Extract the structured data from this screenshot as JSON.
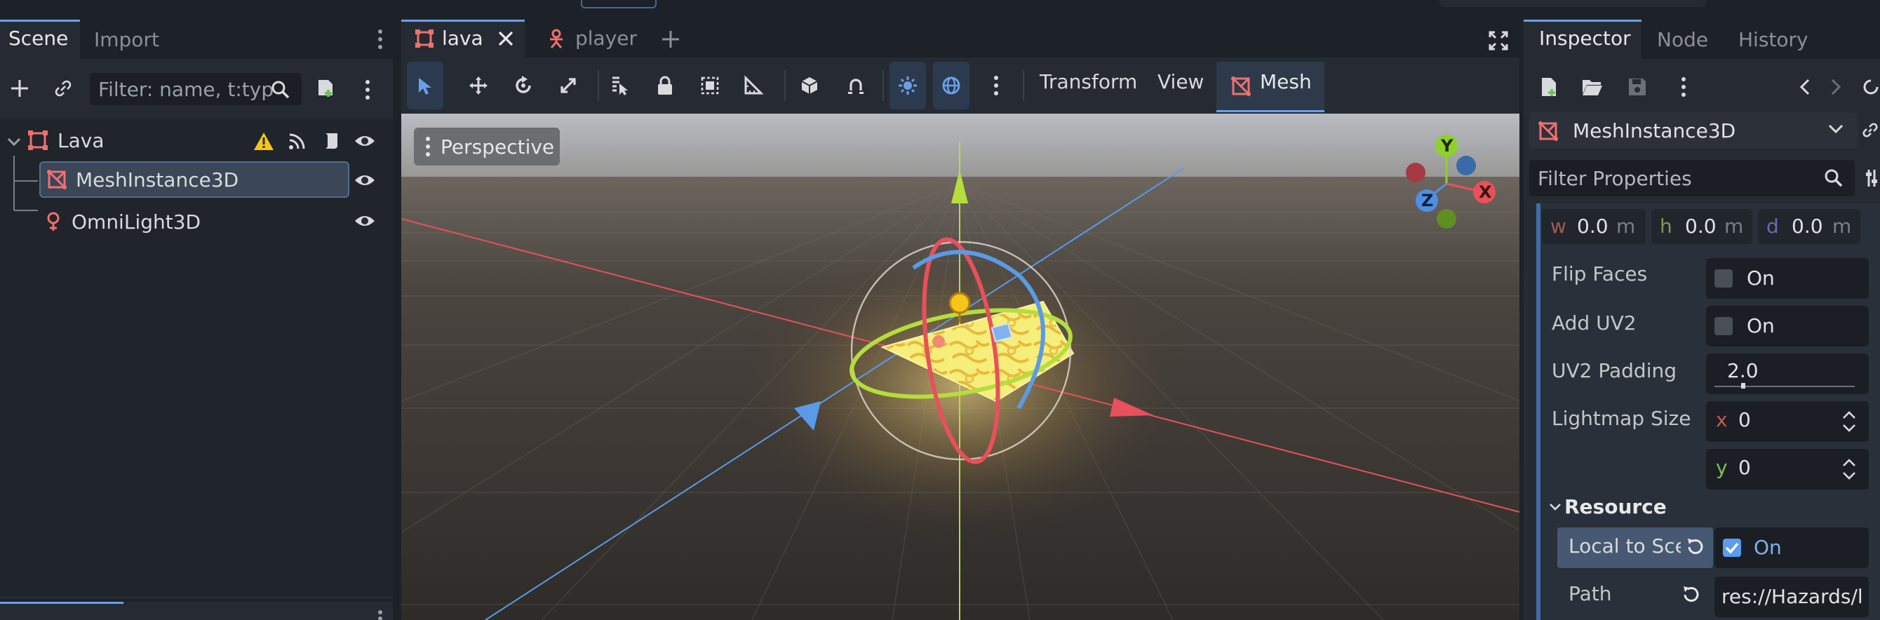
{
  "left_dock": {
    "tabs": [
      {
        "label": "Scene",
        "active": true
      },
      {
        "label": "Import",
        "active": false
      }
    ],
    "filter_placeholder": "Filter: name, t:typ",
    "tree": [
      {
        "label": "Lava",
        "icon": "node3d-icon",
        "warning": true
      },
      {
        "label": "MeshInstance3D",
        "icon": "mesh-instance-icon",
        "selected": true
      },
      {
        "label": "OmniLight3D",
        "icon": "omni-light-icon"
      }
    ]
  },
  "editor_tabs": [
    {
      "label": "lava",
      "active": true,
      "closable": true
    },
    {
      "label": "player",
      "active": false
    }
  ],
  "toolbar": {
    "menus": [
      "Transform",
      "View",
      "Mesh"
    ],
    "active_menu": "Mesh"
  },
  "viewport": {
    "perspective_label": "Perspective",
    "gizmo_axes": [
      "Y",
      "X",
      "Z"
    ]
  },
  "inspector": {
    "tabs": [
      {
        "label": "Inspector",
        "active": true
      },
      {
        "label": "Node"
      },
      {
        "label": "History"
      }
    ],
    "node_type": "MeshInstance3D",
    "filter_placeholder": "Filter Properties",
    "size": {
      "w_label": "w",
      "w_value": "0.0",
      "w_unit": "m",
      "h_label": "h",
      "h_value": "0.0",
      "h_unit": "m",
      "d_label": "d",
      "d_value": "0.0",
      "d_unit": "m"
    },
    "flip_faces": {
      "label": "Flip Faces",
      "value": "On",
      "checked": false
    },
    "add_uv2": {
      "label": "Add UV2",
      "value": "On",
      "checked": false
    },
    "uv2_padding": {
      "label": "UV2 Padding",
      "value": "2.0"
    },
    "lightmap_size": {
      "label": "Lightmap Size",
      "x_label": "x",
      "x_value": "0",
      "y_label": "y",
      "y_value": "0"
    },
    "resource_section": "Resource",
    "local_to_scene": {
      "label": "Local to Sce",
      "value": "On",
      "checked": true
    },
    "path": {
      "label": "Path",
      "value": "res://Hazards/l"
    }
  },
  "colors": {
    "accent": "#6aa0e8",
    "axis_x": "#e8505b",
    "axis_y": "#8ed12c",
    "axis_z": "#4e8fe6",
    "warning": "#f5c518",
    "node_icon": "#f07070"
  }
}
